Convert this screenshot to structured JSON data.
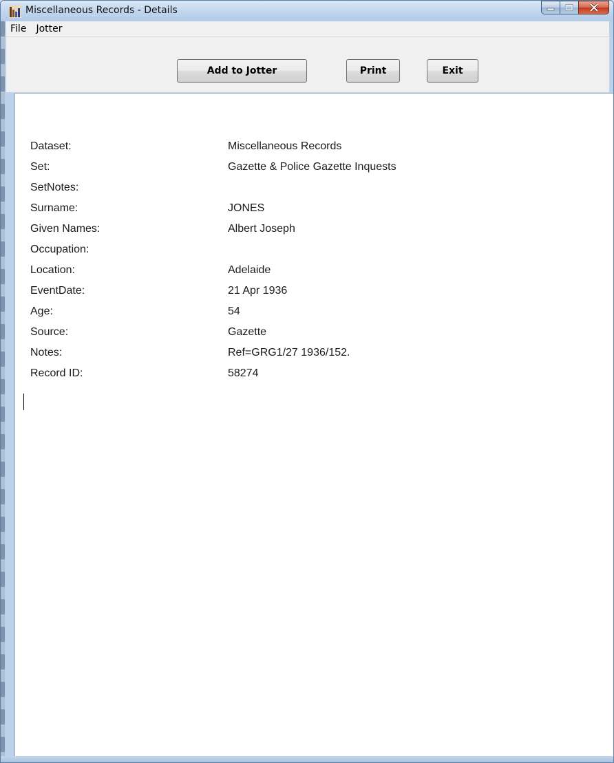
{
  "window": {
    "title": "Miscellaneous Records - Details"
  },
  "menu": {
    "items": [
      "File",
      "Jotter"
    ]
  },
  "toolbar": {
    "add_label": "Add to Jotter",
    "print_label": "Print",
    "exit_label": "Exit"
  },
  "record": {
    "fields": [
      {
        "label": "Dataset:",
        "value": "Miscellaneous Records"
      },
      {
        "label": "Set:",
        "value": "Gazette & Police Gazette Inquests"
      },
      {
        "label": "SetNotes:",
        "value": ""
      },
      {
        "label": "Surname:",
        "value": "JONES"
      },
      {
        "label": "Given Names:",
        "value": "Albert Joseph"
      },
      {
        "label": "Occupation:",
        "value": ""
      },
      {
        "label": "Location:",
        "value": "Adelaide"
      },
      {
        "label": "EventDate:",
        "value": "21 Apr 1936"
      },
      {
        "label": "Age:",
        "value": "54"
      },
      {
        "label": "Source:",
        "value": "Gazette"
      },
      {
        "label": "Notes:",
        "value": "Ref=GRG1/27 1936/152."
      },
      {
        "label": "Record ID:",
        "value": "58274"
      }
    ]
  },
  "icons": {
    "app": "app-icon",
    "minimize": "minimize-icon",
    "maximize": "maximize-icon",
    "close": "close-icon"
  },
  "colors": {
    "titlebar": "#c2d7ee",
    "close_button": "#c0391c",
    "content_bg": "#ffffff"
  }
}
